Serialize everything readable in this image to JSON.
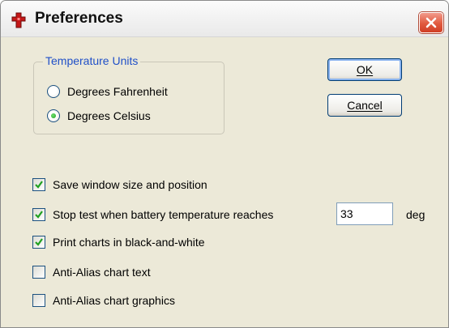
{
  "window": {
    "title": "Preferences"
  },
  "temperature_units": {
    "legend": "Temperature Units",
    "options": [
      {
        "label": "Degrees Fahrenheit",
        "selected": false
      },
      {
        "label": "Degrees Celsius",
        "selected": true
      }
    ]
  },
  "buttons": {
    "ok": "OK",
    "cancel": "Cancel"
  },
  "options": [
    {
      "label": "Save window size and position",
      "checked": true
    },
    {
      "label": "Stop test when battery temperature reaches",
      "checked": true
    },
    {
      "label": "Print charts in black-and-white",
      "checked": true
    },
    {
      "label": "Anti-Alias chart text",
      "checked": false
    },
    {
      "label": "Anti-Alias chart graphics",
      "checked": false
    }
  ],
  "battery_temp": {
    "value": "33",
    "unit": "deg"
  },
  "colors": {
    "legend_text": "#2050c8",
    "check_mark": "#21a121",
    "close_button": "#e15a3f",
    "dialog_background": "#ece9d8"
  },
  "icons": {
    "app": "red-puzzle-piece-icon",
    "close": "close-icon",
    "check": "check-mark-icon"
  }
}
